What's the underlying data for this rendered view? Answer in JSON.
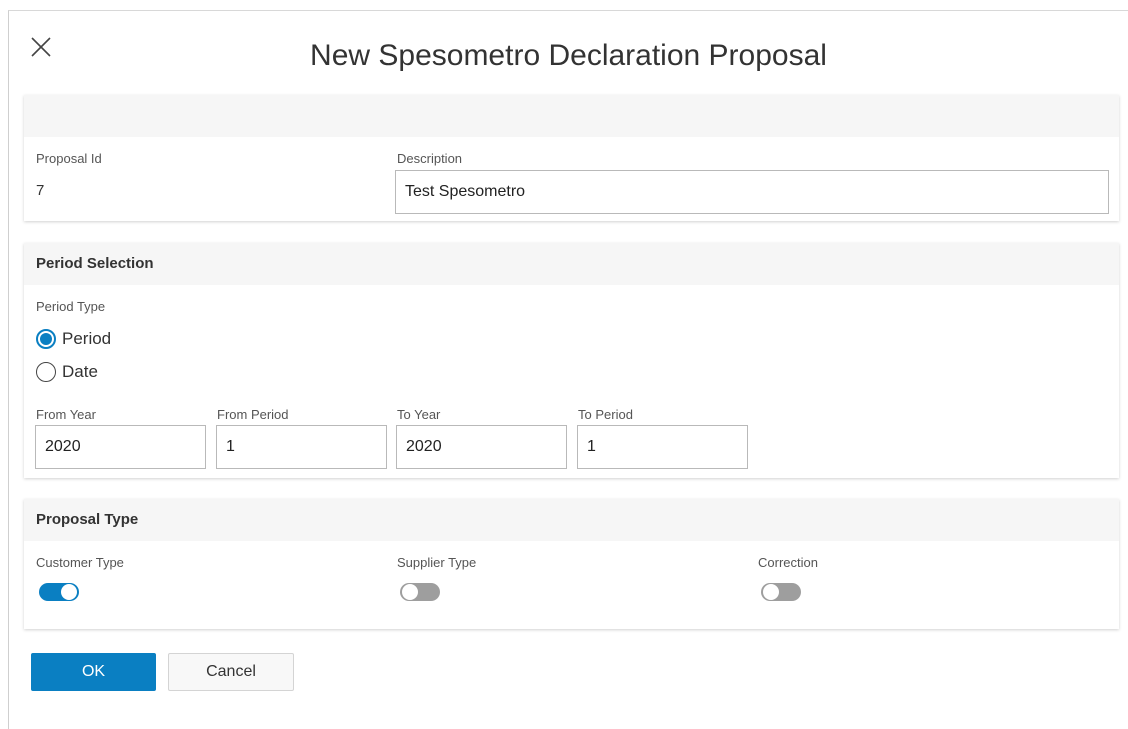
{
  "dialog": {
    "title": "New Spesometro Declaration Proposal",
    "close_icon": "close-icon"
  },
  "general": {
    "proposal_id_label": "Proposal Id",
    "proposal_id_value": "7",
    "description_label": "Description",
    "description_value": "Test Spesometro"
  },
  "period_selection": {
    "header": "Period Selection",
    "period_type_label": "Period Type",
    "options": [
      {
        "label": "Period",
        "checked": true
      },
      {
        "label": "Date",
        "checked": false
      }
    ],
    "from_year_label": "From Year",
    "from_year_value": "2020",
    "from_period_label": "From Period",
    "from_period_value": "1",
    "to_year_label": "To Year",
    "to_year_value": "2020",
    "to_period_label": "To Period",
    "to_period_value": "1"
  },
  "proposal_type": {
    "header": "Proposal Type",
    "toggles": [
      {
        "label": "Customer Type",
        "on": true
      },
      {
        "label": "Supplier Type",
        "on": false
      },
      {
        "label": "Correction",
        "on": false
      }
    ]
  },
  "actions": {
    "ok_label": "OK",
    "cancel_label": "Cancel"
  },
  "colors": {
    "accent": "#0a7fc2",
    "toggle_off": "#9e9e9e",
    "section_header_bg": "#f6f6f6"
  }
}
